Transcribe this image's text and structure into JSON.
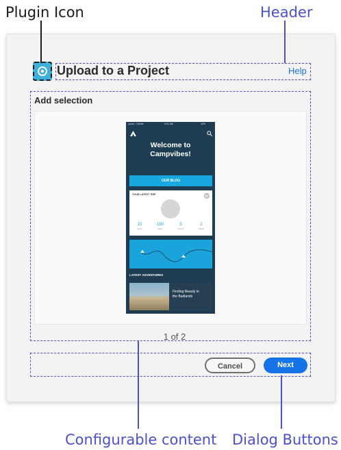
{
  "callouts": {
    "plugin_icon": "Plugin Icon",
    "header": "Header",
    "configurable_content": "Configurable content",
    "dialog_buttons": "Dialog Buttons"
  },
  "dialog": {
    "title": "Upload to a Project",
    "help": "Help",
    "section_label": "Add selection",
    "pager": "1 of 2",
    "buttons": {
      "cancel": "Cancel",
      "next": "Next"
    }
  },
  "phone": {
    "carrier": "Carrier",
    "time": "9:41 AM",
    "battery": "42%",
    "welcome_line1": "Welcome to",
    "welcome_line2": "Campvibes!",
    "blog_button": "OUR BLOG",
    "trip_label": "YOUR LATEST TRIP",
    "stats": [
      {
        "value": "10",
        "label": "Days"
      },
      {
        "value": "180",
        "label": "Miles"
      },
      {
        "value": "5",
        "label": "Camps"
      },
      {
        "value": "2",
        "label": "Meals"
      }
    ],
    "latest_label": "LATEST ADVENTURES",
    "card_title_line1": "Finding Beauty in",
    "card_title_line2": "the Badlands"
  },
  "colors": {
    "annotation": "#4a4fd0",
    "accent": "#1473e6",
    "phone_bg": "#1f3d52",
    "phone_accent": "#16a8df",
    "plugin_icon": "#3fb0d9"
  },
  "icons": {
    "plugin": "gear-icon",
    "phone_logo": "tent-icon",
    "phone_search": "search-icon",
    "trip_settings": "clock-icon"
  }
}
